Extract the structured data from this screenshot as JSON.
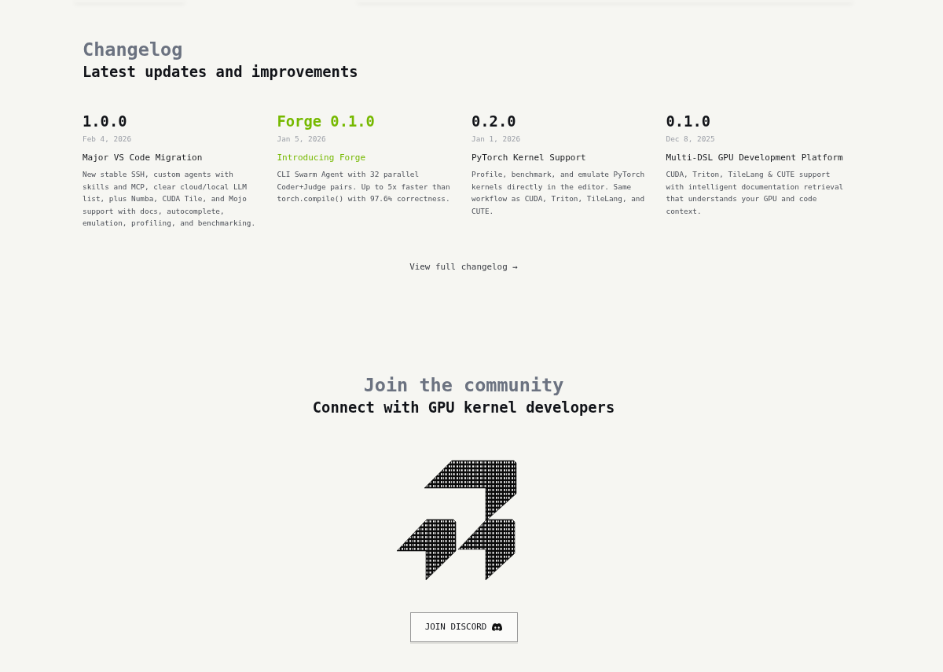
{
  "changelog": {
    "title": "Changelog",
    "subtitle": "Latest updates and improvements"
  },
  "releases": [
    {
      "version": "1.0.0",
      "date": "Feb 4, 2026",
      "title": "Major VS Code Migration",
      "description": "New stable SSH, custom agents with skills and MCP, clear cloud/local LLM list, plus Numba, CUDA Tile, and Mojo support with docs, autocomplete, emulation, profiling, and benchmarking.",
      "featured": false
    },
    {
      "version": "Forge 0.1.0",
      "date": "Jan 5, 2026",
      "title": "Introducing Forge",
      "description": "CLI Swarm Agent with 32 parallel Coder+Judge pairs. Up to 5x faster than torch.compile() with 97.6% correctness.",
      "featured": true
    },
    {
      "version": "0.2.0",
      "date": "Jan 1, 2026",
      "title": "PyTorch Kernel Support",
      "description": "Profile, benchmark, and emulate PyTorch kernels directly in the editor. Same workflow as CUDA, Triton, TileLang, and CUTE.",
      "featured": false
    },
    {
      "version": "0.1.0",
      "date": "Dec 8, 2025",
      "title": "Multi-DSL GPU Development Platform",
      "description": "CUDA, Triton, TileLang & CUTE support with intelligent documentation retrieval that understands your GPU and code context.",
      "featured": false
    }
  ],
  "changelog_link": "View full changelog →",
  "community": {
    "title": "Join the community",
    "subtitle": "Connect with GPU kernel developers",
    "button": "JOIN DISCORD"
  }
}
